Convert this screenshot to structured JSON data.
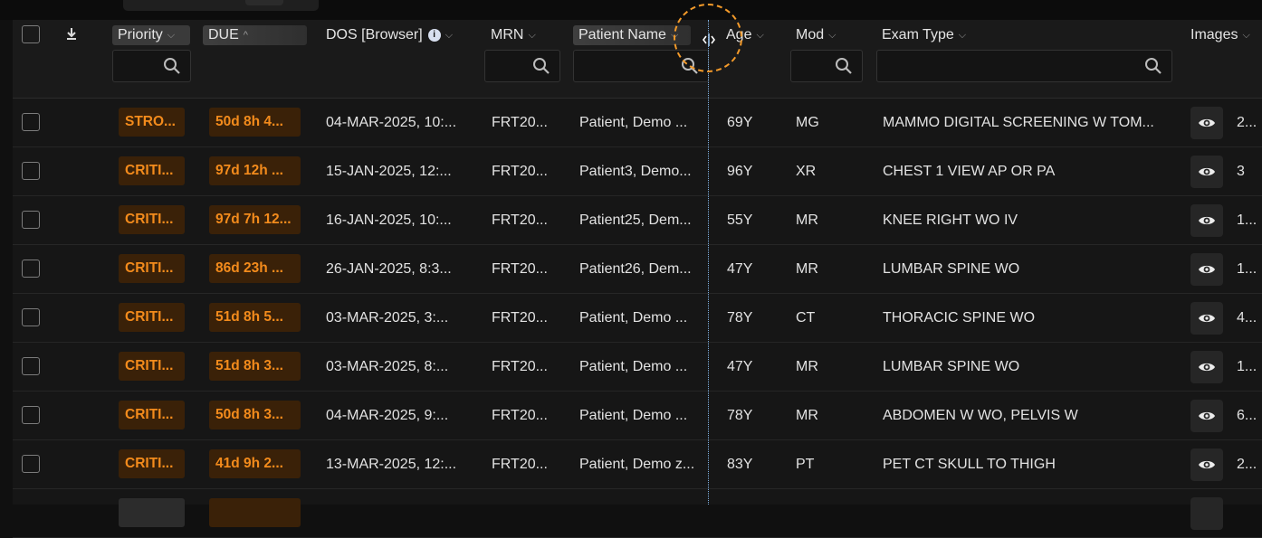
{
  "window": {
    "accent_color": "#f38b1c",
    "status_badge_bg": "#3a2108"
  },
  "columns": [
    {
      "key": "priority",
      "label": "Priority",
      "sort": "none"
    },
    {
      "key": "due",
      "label": "DUE",
      "sort": "asc"
    },
    {
      "key": "dos",
      "label": "DOS [Browser]",
      "sort": "none"
    },
    {
      "key": "mrn",
      "label": "MRN",
      "sort": "none"
    },
    {
      "key": "patient_name",
      "label": "Patient Name",
      "sort": "none"
    },
    {
      "key": "age",
      "label": "Age",
      "sort": "none"
    },
    {
      "key": "mod",
      "label": "Mod",
      "sort": "none"
    },
    {
      "key": "exam_type",
      "label": "Exam Type",
      "sort": "none"
    },
    {
      "key": "images",
      "label": "Images",
      "sort": "none"
    }
  ],
  "icons": {
    "header_checkbox": "checkbox-icon",
    "download": "download-icon",
    "info": "info-icon",
    "info_glyph": "i",
    "sort": "chevron-down-icon",
    "sort_asc": "chevron-up-icon",
    "sort_glyph": "⌵",
    "sort_asc_glyph": "^",
    "search": "search-icon",
    "view": "eye-icon",
    "resize": "column-resize-icon"
  },
  "rows": [
    {
      "priority": "STRO...",
      "due": "50d 8h 4...",
      "dos": "04-MAR-2025, 10:...",
      "mrn": "FRT20...",
      "patient": "Patient, Demo ...",
      "age": "69Y",
      "mod": "MG",
      "exam": "MAMMO DIGITAL SCREENING W TOM...",
      "images": "2..."
    },
    {
      "priority": "CRITI...",
      "due": "97d 12h ...",
      "dos": "15-JAN-2025, 12:...",
      "mrn": "FRT20...",
      "patient": "Patient3, Demo...",
      "age": "96Y",
      "mod": "XR",
      "exam": "CHEST 1 VIEW AP OR PA",
      "images": "3"
    },
    {
      "priority": "CRITI...",
      "due": "97d 7h 12...",
      "dos": "16-JAN-2025, 10:...",
      "mrn": "FRT20...",
      "patient": "Patient25, Dem...",
      "age": "55Y",
      "mod": "MR",
      "exam": "KNEE RIGHT WO IV",
      "images": "1..."
    },
    {
      "priority": "CRITI...",
      "due": "86d 23h ...",
      "dos": "26-JAN-2025, 8:3...",
      "mrn": "FRT20...",
      "patient": "Patient26, Dem...",
      "age": "47Y",
      "mod": "MR",
      "exam": "LUMBAR SPINE WO",
      "images": "1..."
    },
    {
      "priority": "CRITI...",
      "due": "51d 8h 5...",
      "dos": "03-MAR-2025, 3:...",
      "mrn": "FRT20...",
      "patient": "Patient, Demo ...",
      "age": "78Y",
      "mod": "CT",
      "exam": "THORACIC SPINE WO",
      "images": "4..."
    },
    {
      "priority": "CRITI...",
      "due": "51d 8h 3...",
      "dos": "03-MAR-2025, 8:...",
      "mrn": "FRT20...",
      "patient": "Patient, Demo ...",
      "age": "47Y",
      "mod": "MR",
      "exam": "LUMBAR SPINE WO",
      "images": "1..."
    },
    {
      "priority": "CRITI...",
      "due": "50d 8h 3...",
      "dos": "04-MAR-2025, 9:...",
      "mrn": "FRT20...",
      "patient": "Patient, Demo ...",
      "age": "78Y",
      "mod": "MR",
      "exam": "ABDOMEN W WO, PELVIS W",
      "images": "6..."
    },
    {
      "priority": "CRITI...",
      "due": "41d 9h 2...",
      "dos": "13-MAR-2025, 12:...",
      "mrn": "FRT20...",
      "patient": "Patient, Demo z...",
      "age": "83Y",
      "mod": "PT",
      "exam": "PET CT SKULL TO THIGH",
      "images": "2..."
    }
  ]
}
